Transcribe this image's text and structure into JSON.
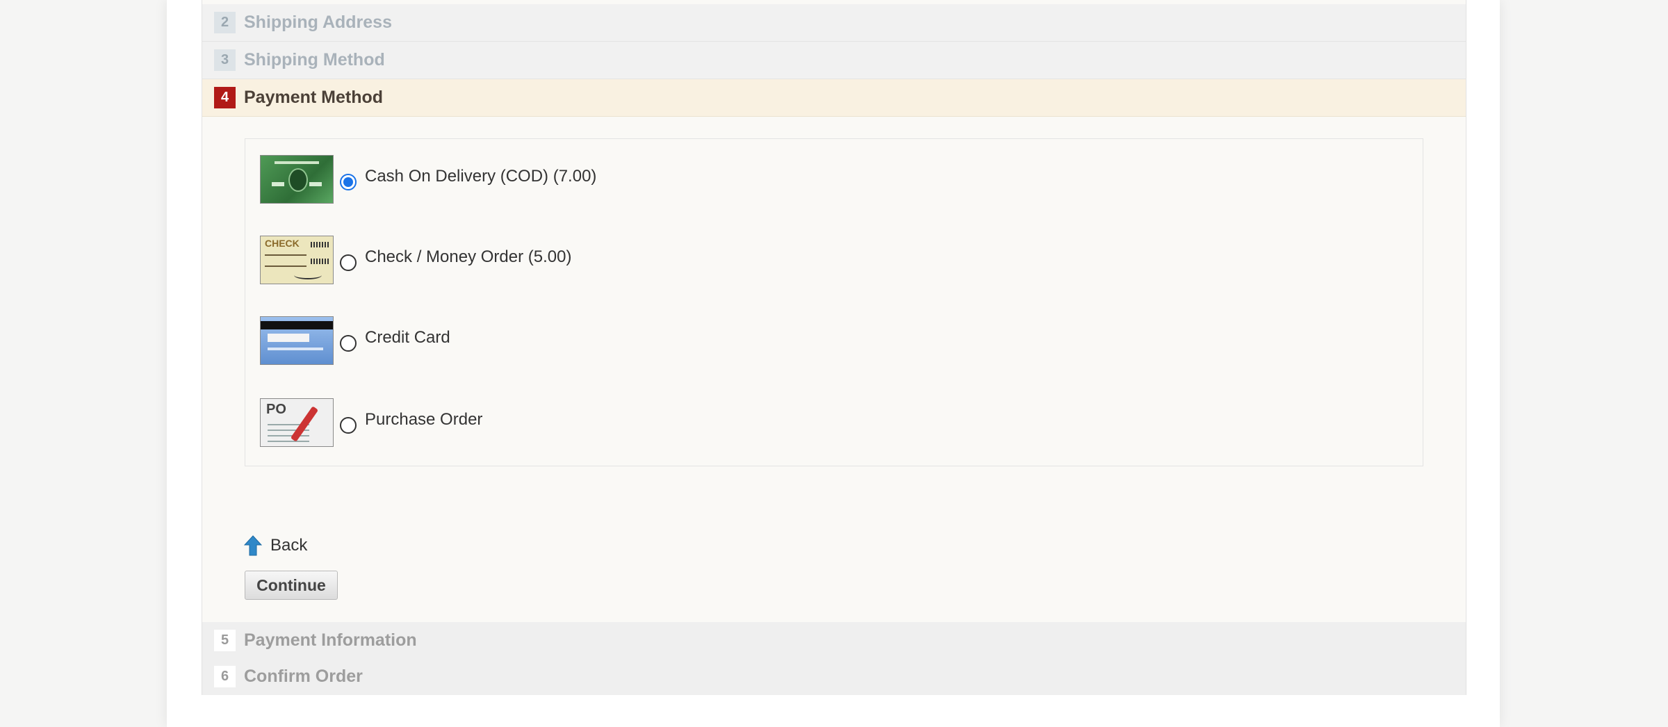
{
  "steps": [
    {
      "num": "2",
      "title": "Shipping Address"
    },
    {
      "num": "3",
      "title": "Shipping Method"
    },
    {
      "num": "4",
      "title": "Payment Method"
    },
    {
      "num": "5",
      "title": "Payment Information"
    },
    {
      "num": "6",
      "title": "Confirm Order"
    }
  ],
  "payment_methods": [
    {
      "label": "Cash On Delivery (COD) (7.00)",
      "selected": true,
      "icon": "green-card-icon"
    },
    {
      "label": "Check / Money Order (5.00)",
      "selected": false,
      "icon": "check-icon"
    },
    {
      "label": "Credit Card",
      "selected": false,
      "icon": "credit-card-icon"
    },
    {
      "label": "Purchase Order",
      "selected": false,
      "icon": "purchase-order-icon"
    }
  ],
  "nav": {
    "back_label": "Back",
    "continue_label": "Continue"
  },
  "colors": {
    "active_step_badge": "#b11a17",
    "active_step_bg": "#f9f1e1",
    "radio_selected": "#1a73e8"
  }
}
